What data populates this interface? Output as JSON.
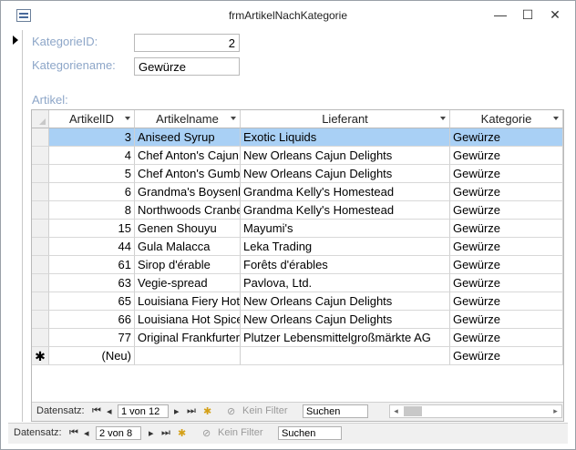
{
  "window": {
    "title": "frmArtikelNachKategorie",
    "minimize": "—",
    "maximize": "☐",
    "close": "✕"
  },
  "form": {
    "kategorieid_label": "KategorieID:",
    "kategorieid_value": "2",
    "kategoriename_label": "Kategoriename:",
    "kategoriename_value": "Gewürze",
    "artikel_label": "Artikel:"
  },
  "subform": {
    "columns": [
      "ArtikelID",
      "Artikelname",
      "Lieferant",
      "Kategorie"
    ],
    "rows": [
      {
        "id": "3",
        "name": "Aniseed Syrup",
        "supplier": "Exotic Liquids",
        "category": "Gewürze"
      },
      {
        "id": "4",
        "name": "Chef Anton's Cajun Seasoning",
        "supplier": "New Orleans Cajun Delights",
        "category": "Gewürze"
      },
      {
        "id": "5",
        "name": "Chef Anton's Gumbo Mix",
        "supplier": "New Orleans Cajun Delights",
        "category": "Gewürze"
      },
      {
        "id": "6",
        "name": "Grandma's Boysenberry Spread",
        "supplier": "Grandma Kelly's Homestead",
        "category": "Gewürze"
      },
      {
        "id": "8",
        "name": "Northwoods Cranberry Sauce",
        "supplier": "Grandma Kelly's Homestead",
        "category": "Gewürze"
      },
      {
        "id": "15",
        "name": "Genen Shouyu",
        "supplier": "Mayumi's",
        "category": "Gewürze"
      },
      {
        "id": "44",
        "name": "Gula Malacca",
        "supplier": "Leka Trading",
        "category": "Gewürze"
      },
      {
        "id": "61",
        "name": "Sirop d'érable",
        "supplier": "Forêts d'érables",
        "category": "Gewürze"
      },
      {
        "id": "63",
        "name": "Vegie-spread",
        "supplier": "Pavlova, Ltd.",
        "category": "Gewürze"
      },
      {
        "id": "65",
        "name": "Louisiana Fiery Hot Pepper Sauce",
        "supplier": "New Orleans Cajun Delights",
        "category": "Gewürze"
      },
      {
        "id": "66",
        "name": "Louisiana Hot Spiced Okra",
        "supplier": "New Orleans Cajun Delights",
        "category": "Gewürze"
      },
      {
        "id": "77",
        "name": "Original Frankfurter grüne Soße",
        "supplier": "Plutzer Lebensmittelgroßmärkte AG",
        "category": "Gewürze"
      }
    ],
    "new_row": {
      "marker": "✱",
      "id": "(Neu)",
      "category": "Gewürze"
    },
    "nav": {
      "label": "Datensatz:",
      "position": "1 von 12",
      "filter": "Kein Filter",
      "search": "Suchen"
    }
  },
  "mainnav": {
    "label": "Datensatz:",
    "position": "2 von 8",
    "filter": "Kein Filter",
    "search": "Suchen"
  },
  "icons": {
    "first": "first-record-icon",
    "prev": "previous-record-icon",
    "next": "next-record-icon",
    "last": "last-record-icon",
    "new": "new-record-icon",
    "filter": "filter-icon"
  },
  "colors": {
    "selected_row": "#a9d0f5",
    "label_text": "#8da6c8"
  }
}
